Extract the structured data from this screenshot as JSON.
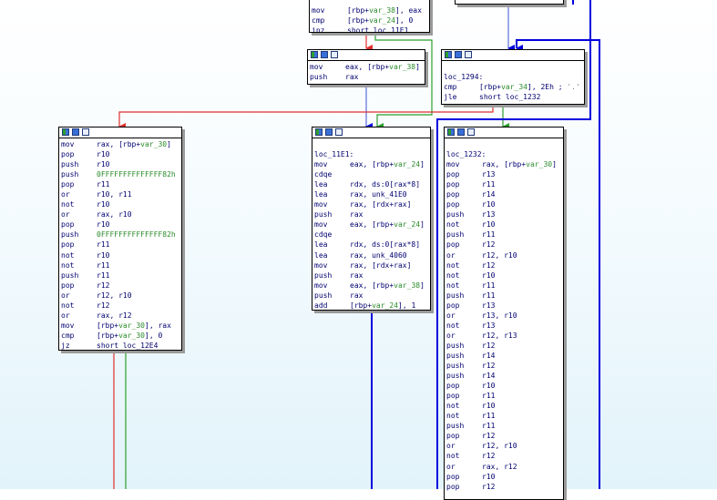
{
  "nodes": [
    {
      "id": "n_top",
      "hidden_title": true,
      "lines": [
        {
          "m": "mov",
          "o": [
            {
              "t": "[rbp+"
            },
            {
              "t": "var_38",
              "c": "var"
            },
            {
              "t": "], eax"
            }
          ]
        },
        {
          "m": "cmp",
          "o": [
            {
              "t": "[rbp+"
            },
            {
              "t": "var_24",
              "c": "var"
            },
            {
              "t": "], 0"
            }
          ]
        },
        {
          "m": "jnz",
          "o": [
            {
              "t": "short loc_11E1"
            }
          ]
        }
      ]
    },
    {
      "id": "n_topright",
      "hidden_title": true,
      "lines": []
    },
    {
      "id": "n_mov38",
      "lines": [
        {
          "m": "mov",
          "o": [
            {
              "t": "eax, [rbp+"
            },
            {
              "t": "var_38",
              "c": "var"
            },
            {
              "t": "]"
            }
          ]
        },
        {
          "m": "push",
          "o": [
            {
              "t": "rax"
            }
          ]
        }
      ]
    },
    {
      "id": "n_1294",
      "lines": [
        {
          "l": ""
        },
        {
          "l": "loc_1294:"
        },
        {
          "m": "cmp",
          "o": [
            {
              "t": "[rbp+"
            },
            {
              "t": "var_34",
              "c": "var"
            },
            {
              "t": "], 2Eh ; "
            },
            {
              "t": "'.'",
              "c": "cmt"
            }
          ]
        },
        {
          "m": "jle",
          "o": [
            {
              "t": "short loc_1232"
            }
          ]
        }
      ]
    },
    {
      "id": "n_left",
      "lines": [
        {
          "m": "mov",
          "o": [
            {
              "t": "rax, [rbp+"
            },
            {
              "t": "var_30",
              "c": "var"
            },
            {
              "t": "]"
            }
          ]
        },
        {
          "m": "pop",
          "o": [
            {
              "t": "r10"
            }
          ]
        },
        {
          "m": "push",
          "o": [
            {
              "t": "r10"
            }
          ]
        },
        {
          "m": "push",
          "o": [
            {
              "t": "0FFFFFFFFFFFFFF82h",
              "c": "var"
            }
          ]
        },
        {
          "m": "pop",
          "o": [
            {
              "t": "r11"
            }
          ]
        },
        {
          "m": "or",
          "o": [
            {
              "t": "r10, r11"
            }
          ]
        },
        {
          "m": "not",
          "o": [
            {
              "t": "r10"
            }
          ]
        },
        {
          "m": "or",
          "o": [
            {
              "t": "rax, r10"
            }
          ]
        },
        {
          "m": "pop",
          "o": [
            {
              "t": "r10"
            }
          ]
        },
        {
          "m": "push",
          "o": [
            {
              "t": "0FFFFFFFFFFFFFF82h",
              "c": "var"
            }
          ]
        },
        {
          "m": "pop",
          "o": [
            {
              "t": "r11"
            }
          ]
        },
        {
          "m": "not",
          "o": [
            {
              "t": "r10"
            }
          ]
        },
        {
          "m": "not",
          "o": [
            {
              "t": "r11"
            }
          ]
        },
        {
          "m": "push",
          "o": [
            {
              "t": "r11"
            }
          ]
        },
        {
          "m": "pop",
          "o": [
            {
              "t": "r12"
            }
          ]
        },
        {
          "m": "or",
          "o": [
            {
              "t": "r12, r10"
            }
          ]
        },
        {
          "m": "not",
          "o": [
            {
              "t": "r12"
            }
          ]
        },
        {
          "m": "or",
          "o": [
            {
              "t": "rax, r12"
            }
          ]
        },
        {
          "m": "mov",
          "o": [
            {
              "t": "[rbp+"
            },
            {
              "t": "var_30",
              "c": "var"
            },
            {
              "t": "], rax"
            }
          ]
        },
        {
          "m": "cmp",
          "o": [
            {
              "t": "[rbp+"
            },
            {
              "t": "var_30",
              "c": "var"
            },
            {
              "t": "], 0"
            }
          ]
        },
        {
          "m": "jz",
          "o": [
            {
              "t": "short loc_12E4"
            }
          ]
        }
      ]
    },
    {
      "id": "n_11E1",
      "lines": [
        {
          "l": ""
        },
        {
          "l": "loc_11E1:"
        },
        {
          "m": "mov",
          "o": [
            {
              "t": "eax, [rbp+"
            },
            {
              "t": "var_24",
              "c": "var"
            },
            {
              "t": "]"
            }
          ]
        },
        {
          "m": "cdqe",
          "o": []
        },
        {
          "m": "lea",
          "o": [
            {
              "t": "rdx, ds:0[rax*8]"
            }
          ]
        },
        {
          "m": "lea",
          "o": [
            {
              "t": "rax, unk_41E0"
            }
          ]
        },
        {
          "m": "mov",
          "o": [
            {
              "t": "rax, [rdx+rax]"
            }
          ]
        },
        {
          "m": "push",
          "o": [
            {
              "t": "rax"
            }
          ]
        },
        {
          "m": "mov",
          "o": [
            {
              "t": "eax, [rbp+"
            },
            {
              "t": "var_24",
              "c": "var"
            },
            {
              "t": "]"
            }
          ]
        },
        {
          "m": "cdqe",
          "o": []
        },
        {
          "m": "lea",
          "o": [
            {
              "t": "rdx, ds:0[rax*8]"
            }
          ]
        },
        {
          "m": "lea",
          "o": [
            {
              "t": "rax, unk_4060"
            }
          ]
        },
        {
          "m": "mov",
          "o": [
            {
              "t": "rax, [rdx+rax]"
            }
          ]
        },
        {
          "m": "push",
          "o": [
            {
              "t": "rax"
            }
          ]
        },
        {
          "m": "mov",
          "o": [
            {
              "t": "eax, [rbp+"
            },
            {
              "t": "var_38",
              "c": "var"
            },
            {
              "t": "]"
            }
          ]
        },
        {
          "m": "push",
          "o": [
            {
              "t": "rax"
            }
          ]
        },
        {
          "m": "add",
          "o": [
            {
              "t": "[rbp+"
            },
            {
              "t": "var_24",
              "c": "var"
            },
            {
              "t": "], 1"
            }
          ]
        }
      ]
    },
    {
      "id": "n_1232",
      "lines": [
        {
          "l": ""
        },
        {
          "l": "loc_1232:"
        },
        {
          "m": "mov",
          "o": [
            {
              "t": "rax, [rbp+"
            },
            {
              "t": "var_30",
              "c": "var"
            },
            {
              "t": "]"
            }
          ]
        },
        {
          "m": "pop",
          "o": [
            {
              "t": "r13"
            }
          ]
        },
        {
          "m": "pop",
          "o": [
            {
              "t": "r11"
            }
          ]
        },
        {
          "m": "pop",
          "o": [
            {
              "t": "r14"
            }
          ]
        },
        {
          "m": "pop",
          "o": [
            {
              "t": "r10"
            }
          ]
        },
        {
          "m": "push",
          "o": [
            {
              "t": "r13"
            }
          ]
        },
        {
          "m": "not",
          "o": [
            {
              "t": "r10"
            }
          ]
        },
        {
          "m": "push",
          "o": [
            {
              "t": "r11"
            }
          ]
        },
        {
          "m": "pop",
          "o": [
            {
              "t": "r12"
            }
          ]
        },
        {
          "m": "or",
          "o": [
            {
              "t": "r12, r10"
            }
          ]
        },
        {
          "m": "not",
          "o": [
            {
              "t": "r12"
            }
          ]
        },
        {
          "m": "not",
          "o": [
            {
              "t": "r10"
            }
          ]
        },
        {
          "m": "not",
          "o": [
            {
              "t": "r11"
            }
          ]
        },
        {
          "m": "push",
          "o": [
            {
              "t": "r11"
            }
          ]
        },
        {
          "m": "pop",
          "o": [
            {
              "t": "r13"
            }
          ]
        },
        {
          "m": "or",
          "o": [
            {
              "t": "r13, r10"
            }
          ]
        },
        {
          "m": "not",
          "o": [
            {
              "t": "r13"
            }
          ]
        },
        {
          "m": "or",
          "o": [
            {
              "t": "r12, r13"
            }
          ]
        },
        {
          "m": "push",
          "o": [
            {
              "t": "r12"
            }
          ]
        },
        {
          "m": "push",
          "o": [
            {
              "t": "r14"
            }
          ]
        },
        {
          "m": "push",
          "o": [
            {
              "t": "r12"
            }
          ]
        },
        {
          "m": "push",
          "o": [
            {
              "t": "r14"
            }
          ]
        },
        {
          "m": "pop",
          "o": [
            {
              "t": "r10"
            }
          ]
        },
        {
          "m": "pop",
          "o": [
            {
              "t": "r11"
            }
          ]
        },
        {
          "m": "not",
          "o": [
            {
              "t": "r10"
            }
          ]
        },
        {
          "m": "not",
          "o": [
            {
              "t": "r11"
            }
          ]
        },
        {
          "m": "push",
          "o": [
            {
              "t": "r11"
            }
          ]
        },
        {
          "m": "pop",
          "o": [
            {
              "t": "r12"
            }
          ]
        },
        {
          "m": "or",
          "o": [
            {
              "t": "r12, r10"
            }
          ]
        },
        {
          "m": "not",
          "o": [
            {
              "t": "r12"
            }
          ]
        },
        {
          "m": "or",
          "o": [
            {
              "t": "rax, r12"
            }
          ]
        },
        {
          "m": "pop",
          "o": [
            {
              "t": "r10"
            }
          ]
        },
        {
          "m": "pop",
          "o": [
            {
              "t": "r12"
            }
          ]
        }
      ]
    }
  ],
  "colors": {
    "true_branch": "#2ca02c",
    "false_branch": "#e03030",
    "jump": "#0000dd",
    "text": "#000070",
    "var": "#2b8b2b"
  }
}
